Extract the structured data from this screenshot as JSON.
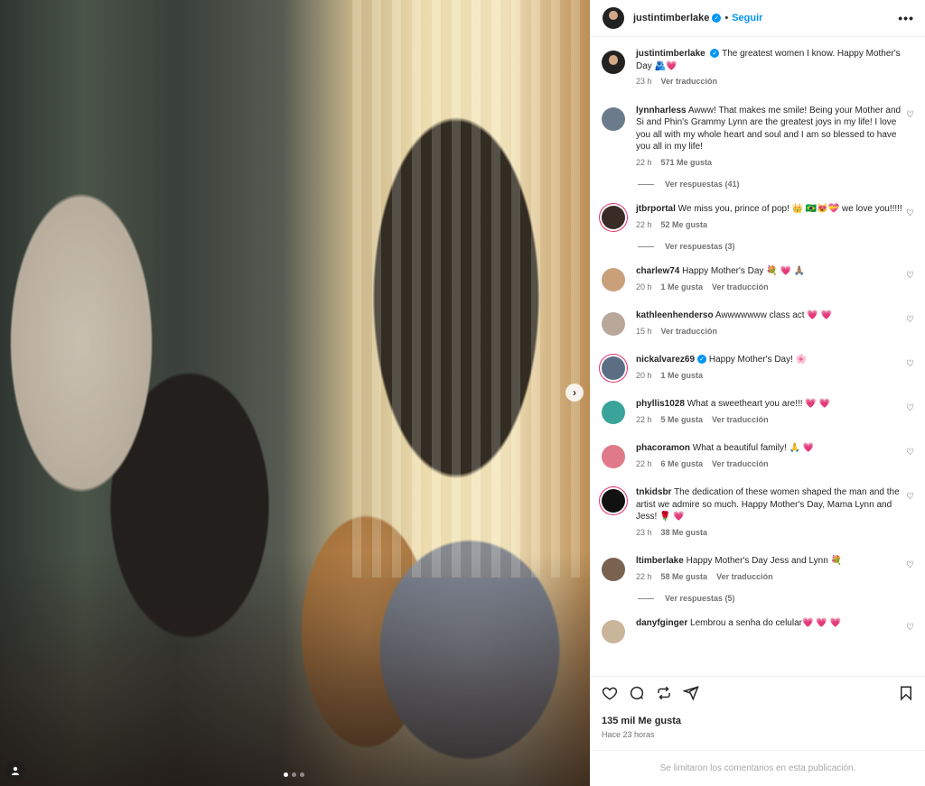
{
  "post": {
    "username": "justintimberlake",
    "verified": true,
    "follow_label": "Seguir",
    "separator": "•",
    "more_icon": "more-horizontal-icon",
    "media": {
      "carousel_count": 3,
      "carousel_active": 0,
      "next_icon": "chevron-right-icon",
      "tag_icon": "person-tag-icon"
    },
    "caption": {
      "username": "justintimberlake",
      "text": "The greatest women I know. Happy Mother's Day 🫂💗",
      "time": "23 h",
      "translate_label": "Ver traducción"
    },
    "likes": "135 mil Me gusta",
    "posted_ago": "Hace 23 horas",
    "comments_disabled": "Se limitaron los comentarios en esta publicación."
  },
  "comments": [
    {
      "username": "lynnharless",
      "text": "Awww! That makes me smile! Being your Mother and Si and Phin's Grammy Lynn are the greatest joys in my life! I love you all with my whole heart and soul and I am so blessed to have you all in my life!",
      "time": "22 h",
      "likes": "571 Me gusta",
      "translate": "",
      "replies": "Ver respuestas (41)",
      "avatar_color": "#6b7b8c",
      "verified": false,
      "story": false
    },
    {
      "username": "jtbrportal",
      "text": "We miss you, prince of pop! 👑 🇧🇷😻💝 we love you!!!!!",
      "time": "22 h",
      "likes": "52 Me gusta",
      "translate": "",
      "replies": "Ver respuestas (3)",
      "avatar_color": "#3a2b24",
      "verified": false,
      "story": true
    },
    {
      "username": "charlew74",
      "text": "Happy Mother's Day 💐 💗 🙏🏽",
      "time": "20 h",
      "likes": "1 Me gusta",
      "translate": "Ver traducción",
      "replies": "",
      "avatar_color": "#c9a07a",
      "verified": false,
      "story": false
    },
    {
      "username": "kathleenhenderso",
      "text": "Awwwwwww class act 💗 💗",
      "time": "15 h",
      "likes": "",
      "translate": "Ver traducción",
      "replies": "",
      "avatar_color": "#b9a79a",
      "verified": false,
      "story": false
    },
    {
      "username": "nickalvarez69",
      "text": "Happy Mother's Day! 🌸",
      "time": "20 h",
      "likes": "1 Me gusta",
      "translate": "",
      "replies": "",
      "avatar_color": "#5a6e84",
      "verified": true,
      "story": true
    },
    {
      "username": "phyllis1028",
      "text": "What a sweetheart you are!!! 💗 💗",
      "time": "22 h",
      "likes": "5 Me gusta",
      "translate": "Ver traducción",
      "replies": "",
      "avatar_color": "#3aa39a",
      "verified": false,
      "story": false
    },
    {
      "username": "phacoramon",
      "text": "What a beautiful family! 🙏 💗",
      "time": "22 h",
      "likes": "6 Me gusta",
      "translate": "Ver traducción",
      "replies": "",
      "avatar_color": "#e07a8a",
      "verified": false,
      "story": false
    },
    {
      "username": "tnkidsbr",
      "text": "The dedication of these women shaped the man and the artist we admire so much. Happy Mother's Day, Mama Lynn and Jess! 🌹 💗",
      "time": "23 h",
      "likes": "38 Me gusta",
      "translate": "",
      "replies": "",
      "avatar_color": "#111111",
      "verified": false,
      "story": true
    },
    {
      "username": "ltimberlake",
      "text": "Happy Mother's Day Jess and Lynn 💐",
      "time": "22 h",
      "likes": "58 Me gusta",
      "translate": "Ver traducción",
      "replies": "Ver respuestas (5)",
      "avatar_color": "#7a6250",
      "verified": false,
      "story": false
    },
    {
      "username": "danyfginger",
      "text": "Lembrou a senha do celular💗 💗 💗",
      "time": "",
      "likes": "",
      "translate": "",
      "replies": "",
      "avatar_color": "#c9b59a",
      "verified": false,
      "story": false
    }
  ],
  "icons": {
    "like": "heart-icon",
    "comment": "comment-icon",
    "repost": "repost-icon",
    "share": "share-icon",
    "save": "bookmark-icon"
  }
}
